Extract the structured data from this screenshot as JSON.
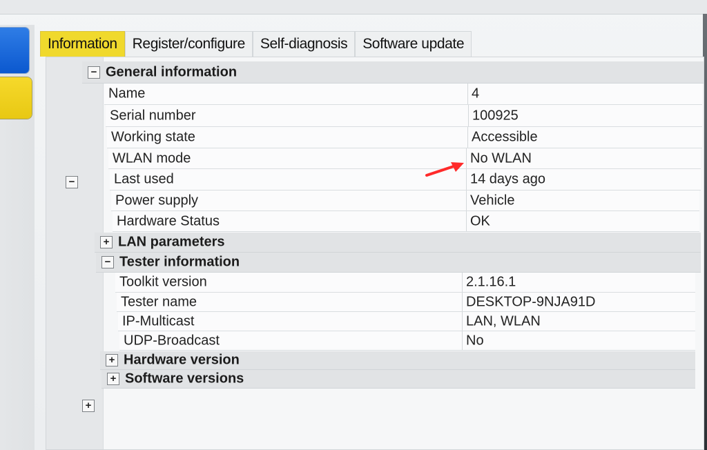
{
  "tabs": [
    {
      "label": "Information",
      "active": true
    },
    {
      "label": "Register/configure",
      "active": false
    },
    {
      "label": "Self-diagnosis",
      "active": false
    },
    {
      "label": "Software update",
      "active": false
    }
  ],
  "tree_symbols": {
    "expand": "+",
    "collapse": "−"
  },
  "general_information": {
    "title": "General information",
    "rows": [
      {
        "label": "Name",
        "value": "4"
      },
      {
        "label": "Serial number",
        "value": "100925"
      },
      {
        "label": "Working state",
        "value": "Accessible"
      },
      {
        "label": "WLAN mode",
        "value": "No WLAN"
      },
      {
        "label": "Last used",
        "value": "14 days ago"
      },
      {
        "label": "Power supply",
        "value": "Vehicle"
      },
      {
        "label": "Hardware Status",
        "value": "OK"
      }
    ]
  },
  "lan_parameters": {
    "title": "LAN parameters"
  },
  "tester_information": {
    "title": "Tester information",
    "rows": [
      {
        "label": "Toolkit version",
        "value": "2.1.16.1"
      },
      {
        "label": "Tester name",
        "value": "DESKTOP-9NJA91D"
      },
      {
        "label": "IP-Multicast",
        "value": "LAN, WLAN"
      },
      {
        "label": "UDP-Broadcast",
        "value": "No"
      }
    ]
  },
  "hardware_version": {
    "title": "Hardware version"
  },
  "software_versions": {
    "title": "Software versions"
  },
  "colors": {
    "tab_active": "#f0d92d",
    "side_blue": "#0b58cf",
    "side_yellow": "#e8c813",
    "arrow_red": "#ff2a2a"
  }
}
